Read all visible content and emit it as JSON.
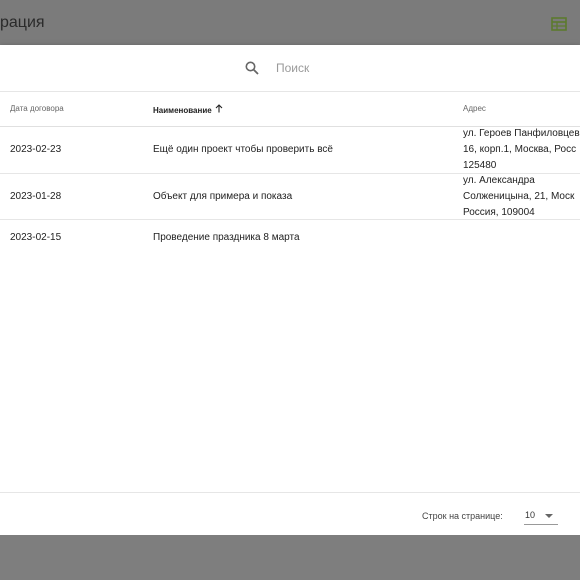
{
  "header": {
    "title": "рация",
    "table_icon": "table-view-icon"
  },
  "search": {
    "icon": "search-icon",
    "placeholder": "Поиск",
    "value": ""
  },
  "table": {
    "columns": [
      {
        "label": "Дата договора",
        "sorted": false
      },
      {
        "label": "Наименование",
        "sorted": true,
        "sort_direction": "ascending",
        "sort_icon": "arrow-up-icon"
      },
      {
        "label": "Адрес",
        "sorted": false
      }
    ],
    "rows": [
      {
        "date": "2023-02-23",
        "name": "Ещё один проект чтобы проверить всё",
        "address": [
          "ул. Героев Панфиловцев",
          "16, корп.1, Москва, Росс",
          "125480"
        ]
      },
      {
        "date": "2023-01-28",
        "name": "Объект для примера и показа",
        "address": [
          "ул. Александра",
          "Солженицына, 21, Моск",
          "Россия, 109004"
        ]
      },
      {
        "date": "2023-02-15",
        "name": "Проведение праздника 8 марта",
        "address": []
      }
    ]
  },
  "pagination": {
    "rows_per_page_label": "Строк на странице:",
    "rows_per_page_value": "10",
    "dropdown_icon": "caret-down-icon"
  },
  "colors": {
    "overlay": "#7e7e7e",
    "panel": "#ffffff",
    "icon_accent": "#5c7a2e"
  }
}
